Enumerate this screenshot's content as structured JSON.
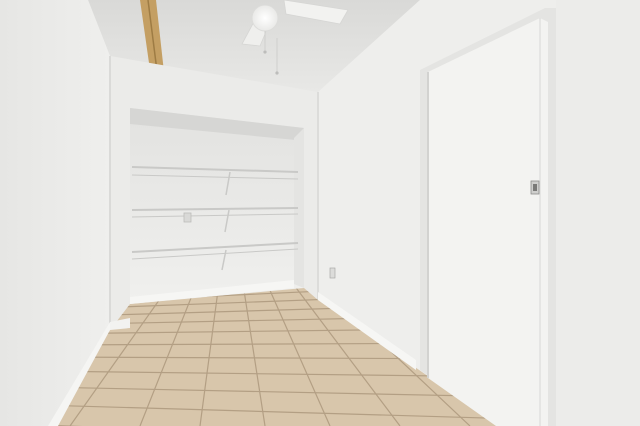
{
  "scene": {
    "type": "photo",
    "subject": "empty-room-with-closet-and-door",
    "colors": {
      "wall": "#ececea",
      "wall_shadow": "#dcdcda",
      "ceiling": "#e3e3e1",
      "tile": "#d8c6ab",
      "grout": "#b39f84",
      "baseboard": "#f4f4f2",
      "door": "#f2f2f0",
      "beam": "#c8a56a"
    }
  }
}
